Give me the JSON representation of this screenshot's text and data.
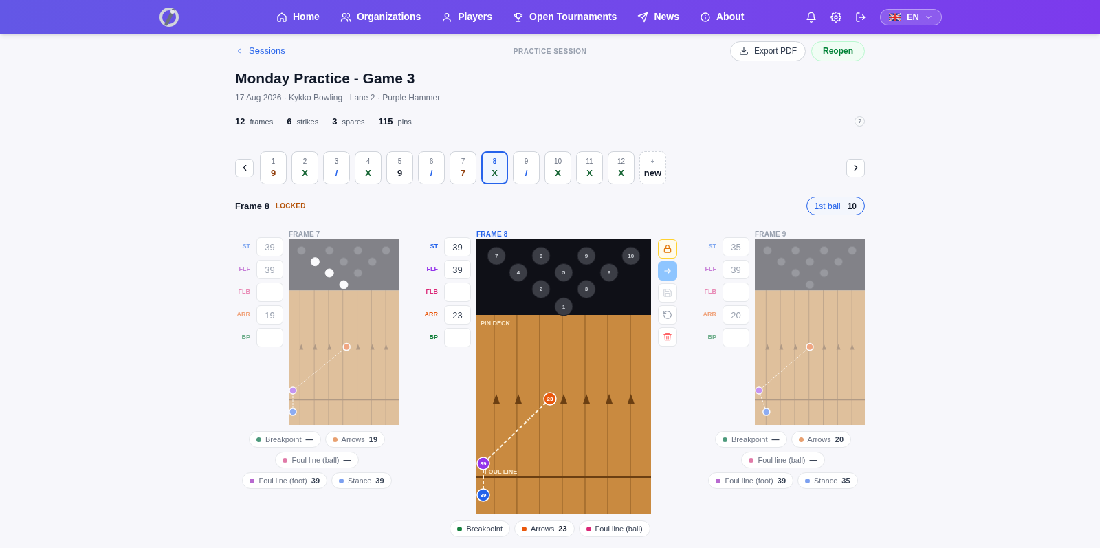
{
  "nav": {
    "items": [
      {
        "label": "Home"
      },
      {
        "label": "Organizations"
      },
      {
        "label": "Players"
      },
      {
        "label": "Open Tournaments"
      },
      {
        "label": "News"
      },
      {
        "label": "About"
      }
    ],
    "language": "EN"
  },
  "back_link": "Sessions",
  "section_label": "PRACTICE SESSION",
  "actions": [
    {
      "label": "Export PDF",
      "kind": "export"
    },
    {
      "label": "Reopen",
      "kind": "reopen"
    }
  ],
  "title": "Monday Practice - Game 3",
  "subtitle": "17 Aug 2026 · Kykko Bowling · Lane 2 · Purple Hammer",
  "stats": [
    "**12** frames",
    "**6** strikes",
    "**3** spares",
    "**115** pins"
  ],
  "help": "?",
  "frames": [
    {
      "number": "1",
      "mark": "9",
      "color": "#92400e",
      "selected": false,
      "kind": "frame"
    },
    {
      "number": "2",
      "mark": "X",
      "color": "#166534",
      "selected": false,
      "kind": "frame"
    },
    {
      "number": "3",
      "mark": "/",
      "color": "#2563eb",
      "selected": false,
      "kind": "frame"
    },
    {
      "number": "4",
      "mark": "X",
      "color": "#166534",
      "selected": false,
      "kind": "frame"
    },
    {
      "number": "5",
      "mark": "9",
      "color": "#111827",
      "selected": false,
      "kind": "frame"
    },
    {
      "number": "6",
      "mark": "/",
      "color": "#2563eb",
      "selected": false,
      "kind": "frame"
    },
    {
      "number": "7",
      "mark": "7",
      "color": "#92400e",
      "selected": false,
      "kind": "frame"
    },
    {
      "number": "8",
      "mark": "X",
      "color": "#166534",
      "selected": true,
      "kind": "frame"
    },
    {
      "number": "9",
      "mark": "/",
      "color": "#2563eb",
      "selected": false,
      "kind": "frame"
    },
    {
      "number": "10",
      "mark": "X",
      "color": "#166534",
      "selected": false,
      "kind": "frame"
    },
    {
      "number": "11",
      "mark": "X",
      "color": "#166534",
      "selected": false,
      "kind": "frame"
    },
    {
      "number": "12",
      "mark": "X",
      "color": "#166534",
      "selected": false,
      "kind": "frame"
    },
    {
      "number": "+",
      "mark": "new",
      "selected": false,
      "kind": "new"
    }
  ],
  "frame_header": {
    "title": "Frame 8",
    "status": "LOCKED",
    "ball_label": "1st ball",
    "ball_value": "10"
  },
  "lanes": [
    {
      "title": "FRAME 7",
      "selected": false,
      "fields": [
        {
          "label": "ST",
          "value": "39",
          "color": "#7ea6f0"
        },
        {
          "label": "FLF",
          "value": "39",
          "color": "#c77fd8"
        },
        {
          "label": "FLB",
          "color": "#e889b5"
        },
        {
          "label": "ARR",
          "value": "19",
          "color": "#f0a27a"
        },
        {
          "label": "BP",
          "color": "#6fae8c"
        }
      ],
      "pins": [
        {
          "standing": false
        },
        {
          "standing": false
        },
        {
          "standing": false
        },
        {
          "standing": false
        },
        {
          "standing": true
        },
        {
          "standing": false
        },
        {
          "standing": false
        },
        {
          "standing": true
        },
        {
          "standing": false
        },
        {
          "standing": true
        }
      ],
      "legend": [
        {
          "text": "Breakpoint **—**",
          "color": "#4d9a7c"
        },
        {
          "text": "Arrows **19**",
          "color": "#e8a070"
        },
        {
          "text": "Foul line (ball) **—**",
          "color": "#e07aa8"
        },
        {
          "text": "Foul line (foot) **39**",
          "color": "#b86ad0"
        },
        {
          "text": "Stance **39**",
          "color": "#7ca0f0"
        }
      ]
    },
    {
      "title": "FRAME 8",
      "selected": true,
      "fields": [
        {
          "label": "ST",
          "value": "39",
          "color": "#2563eb"
        },
        {
          "label": "FLF",
          "value": "39",
          "color": "#9333ea"
        },
        {
          "label": "FLB",
          "color": "#db2777"
        },
        {
          "label": "ARR",
          "value": "23",
          "color": "#ea580c"
        },
        {
          "label": "BP",
          "color": "#15803d"
        }
      ],
      "pins": [
        {
          "label": "7",
          "standing": false
        },
        {
          "label": "8",
          "standing": false
        },
        {
          "label": "9",
          "standing": false
        },
        {
          "label": "10",
          "standing": false
        },
        {
          "label": "4",
          "standing": false
        },
        {
          "label": "5",
          "standing": false
        },
        {
          "label": "6",
          "standing": false
        },
        {
          "label": "2",
          "standing": false
        },
        {
          "label": "3",
          "standing": false
        },
        {
          "label": "1",
          "standing": false
        }
      ],
      "deck_label": "PIN DECK",
      "foul_label": "FOUL LINE",
      "markers": [
        {
          "kind": "arrows",
          "label": "23"
        },
        {
          "kind": "foot",
          "label": "39"
        },
        {
          "kind": "stance",
          "label": "39"
        }
      ],
      "legend": [
        {
          "text": "Breakpoint",
          "color": "#15803d"
        },
        {
          "text": "Arrows **23**",
          "color": "#ea580c"
        },
        {
          "text": "Foul line (ball)",
          "color": "#db2777"
        }
      ]
    },
    {
      "title": "FRAME 9",
      "selected": false,
      "fields": [
        {
          "label": "ST",
          "value": "35",
          "color": "#7ea6f0"
        },
        {
          "label": "FLF",
          "value": "39",
          "color": "#c77fd8"
        },
        {
          "label": "FLB",
          "color": "#e889b5"
        },
        {
          "label": "ARR",
          "value": "20",
          "color": "#f0a27a"
        },
        {
          "label": "BP",
          "color": "#6fae8c"
        }
      ],
      "pins": [
        {
          "standing": false
        },
        {
          "standing": false
        },
        {
          "standing": false
        },
        {
          "standing": false
        },
        {
          "standing": false
        },
        {
          "standing": false
        },
        {
          "standing": false
        },
        {
          "standing": false
        },
        {
          "standing": false
        },
        {
          "standing": false
        }
      ],
      "legend": [
        {
          "text": "Breakpoint **—**",
          "color": "#4d9a7c"
        },
        {
          "text": "Arrows **20**",
          "color": "#e8a070"
        },
        {
          "text": "Foul line (ball) **—**",
          "color": "#e07aa8"
        },
        {
          "text": "Foul line (foot) **39**",
          "color": "#b86ad0"
        },
        {
          "text": "Stance **35**",
          "color": "#7ca0f0"
        }
      ]
    }
  ]
}
